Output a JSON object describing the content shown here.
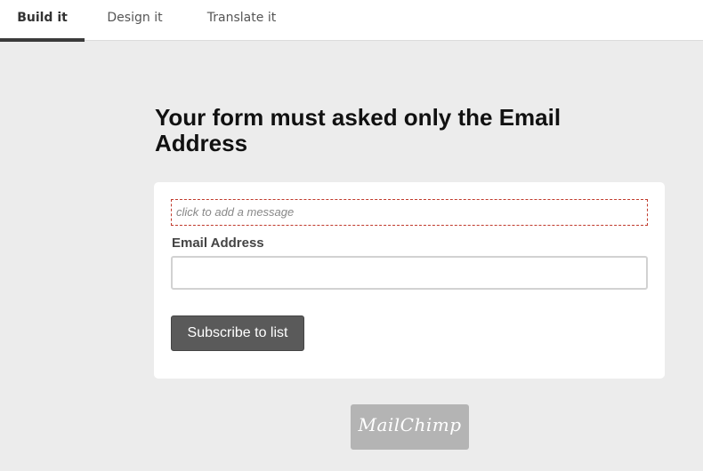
{
  "tabs": [
    {
      "label": "Build it",
      "active": true
    },
    {
      "label": "Design it",
      "active": false
    },
    {
      "label": "Translate it",
      "active": false
    }
  ],
  "form": {
    "headline": "Your form must asked only the Email Address",
    "message_placeholder": "click to add a message",
    "email_label": "Email Address",
    "email_value": "",
    "subscribe_label": "Subscribe to list"
  },
  "footer": {
    "logo_text": "MailChimp"
  },
  "colors": {
    "background": "#ececec",
    "active_tab_underline": "#3b3b3b",
    "button": "#5a5a5a",
    "message_border": "#c0392b",
    "logo_badge": "#b4b4b4"
  }
}
